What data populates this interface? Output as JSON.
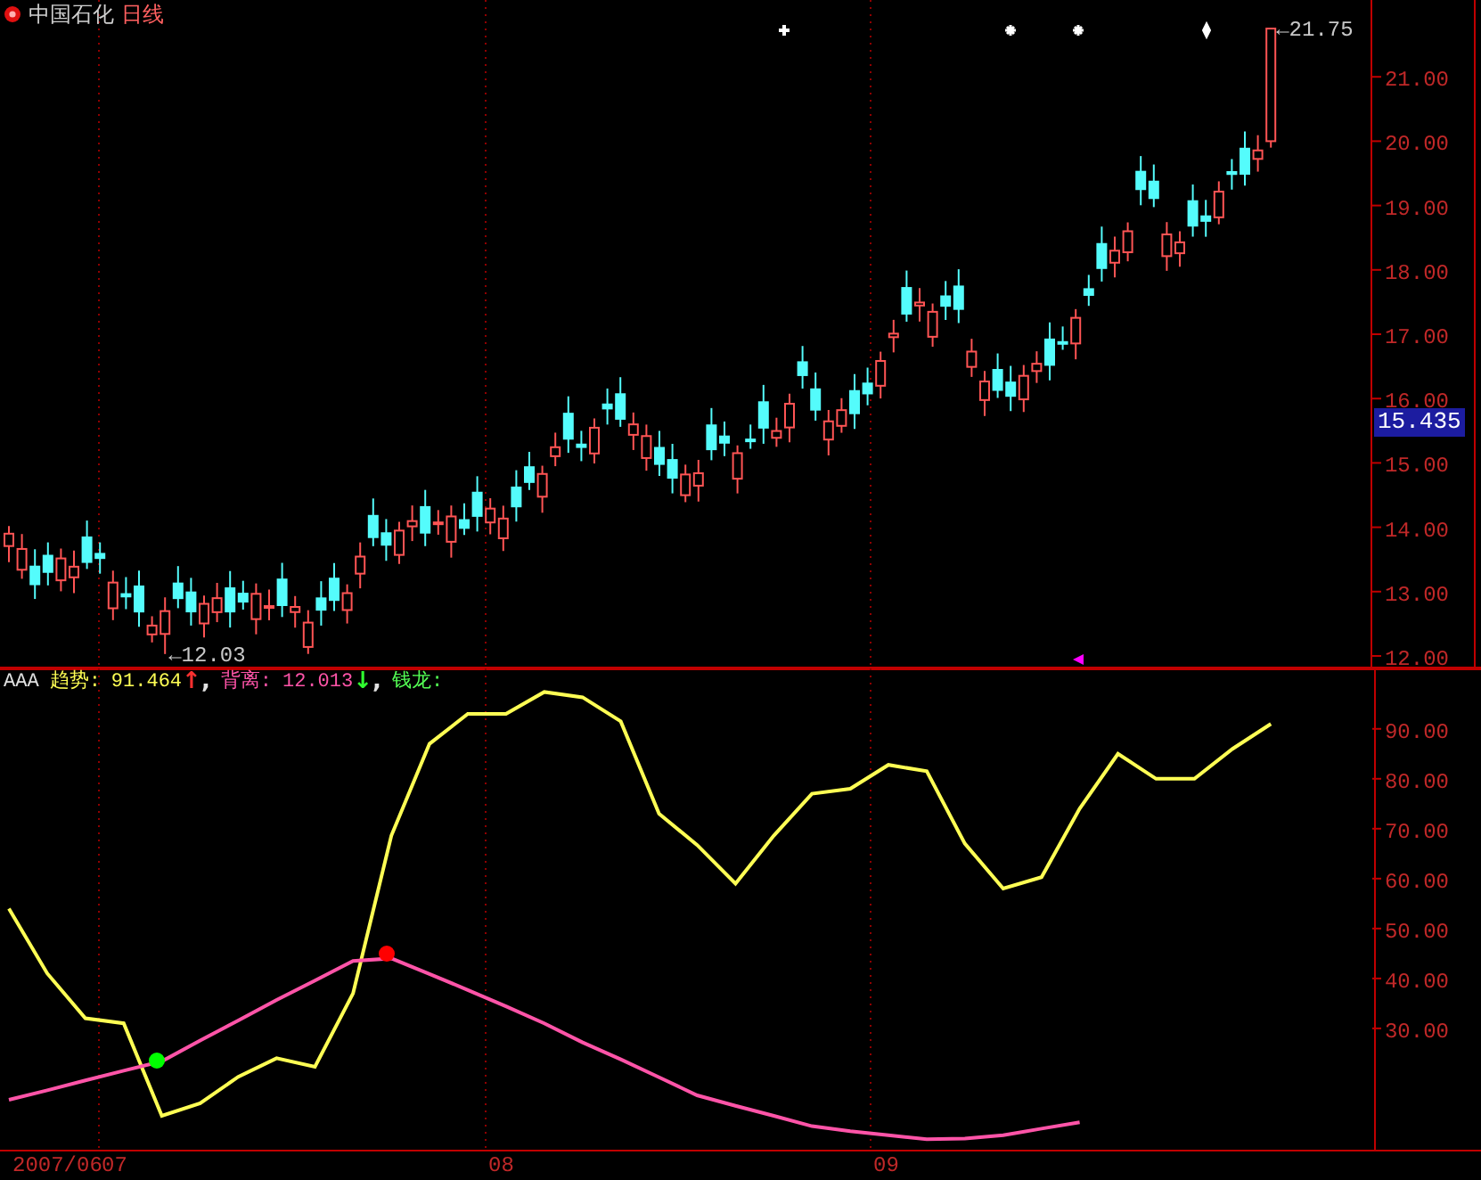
{
  "title": {
    "stock": "中国石化",
    "period": "日线"
  },
  "price_panel": {
    "axis_labels": [
      "21.00",
      "20.00",
      "19.00",
      "18.00",
      "17.00",
      "16.00",
      "15.00",
      "14.00",
      "13.00",
      "12.00"
    ],
    "high_label": "←21.75",
    "low_label": "←12.03",
    "current_price": "15.435"
  },
  "indicator": {
    "legend": [
      {
        "text": "AAA",
        "color": "#e0e0e0"
      },
      {
        "text": "趋势:",
        "color": "#ffff54"
      },
      {
        "text": "91.464",
        "color": "#ffff54"
      },
      {
        "text": "↑",
        "color": "#ff3030"
      },
      {
        "text": ",",
        "color": "#e0e0e0"
      },
      {
        "text": "背离:",
        "color": "#ff54a8"
      },
      {
        "text": "12.013",
        "color": "#ff54a8"
      },
      {
        "text": "↓",
        "color": "#30ff30"
      },
      {
        "text": ",",
        "color": "#e0e0e0"
      },
      {
        "text": "钱龙:",
        "color": "#54ff54"
      }
    ],
    "date_axis": [
      "2007/06",
      "07",
      "08",
      "09"
    ],
    "signal_dots": [
      {
        "color": "#00ff00"
      },
      {
        "color": "#ff0000"
      }
    ],
    "chart_data": {
      "type": "line",
      "categories": [
        null,
        null,
        null,
        null,
        null,
        null,
        null,
        null,
        null,
        null,
        null,
        null,
        null,
        null,
        null,
        null,
        null,
        null,
        null,
        null,
        null,
        null,
        null,
        null,
        null,
        null,
        null,
        null,
        null,
        null,
        null,
        null,
        null,
        null
      ],
      "series": [
        {
          "color": "#ffff54",
          "values": [
            54,
            41,
            32,
            31,
            12.5,
            15,
            20.3,
            24,
            22.3,
            37,
            68.6,
            87,
            93,
            93,
            97.4,
            96.3,
            91.5,
            73,
            66.7,
            59,
            68.6,
            77,
            78,
            82.8,
            81.5,
            67,
            58,
            60.3,
            74,
            85,
            80,
            80,
            86,
            91
          ]
        },
        {
          "color": "#ff54a8",
          "values": [
            15.7,
            17.6,
            19.6,
            21.5,
            23.4,
            27.6,
            31.6,
            35.7,
            39.6,
            43.5,
            44,
            40.9,
            37.7,
            34.4,
            31,
            27.2,
            23.8,
            20.2,
            16.6,
            14.5,
            12.5,
            10.4,
            9.4,
            8.6,
            7.8,
            7.9,
            8.6,
            9.9,
            11.2,
            null,
            null,
            null,
            null,
            null
          ]
        }
      ],
      "ylim": [
        5.7,
        102.1
      ],
      "yticks": [
        {
          "value": 90,
          "label": "90.00"
        },
        {
          "value": 80,
          "label": "80.00"
        },
        {
          "value": 70,
          "label": "70.00"
        },
        {
          "value": 60,
          "label": "60.00"
        },
        {
          "value": 50,
          "label": "50.00"
        },
        {
          "value": 40,
          "label": "40.00"
        },
        {
          "value": 30,
          "label": "30.00"
        }
      ]
    }
  }
}
